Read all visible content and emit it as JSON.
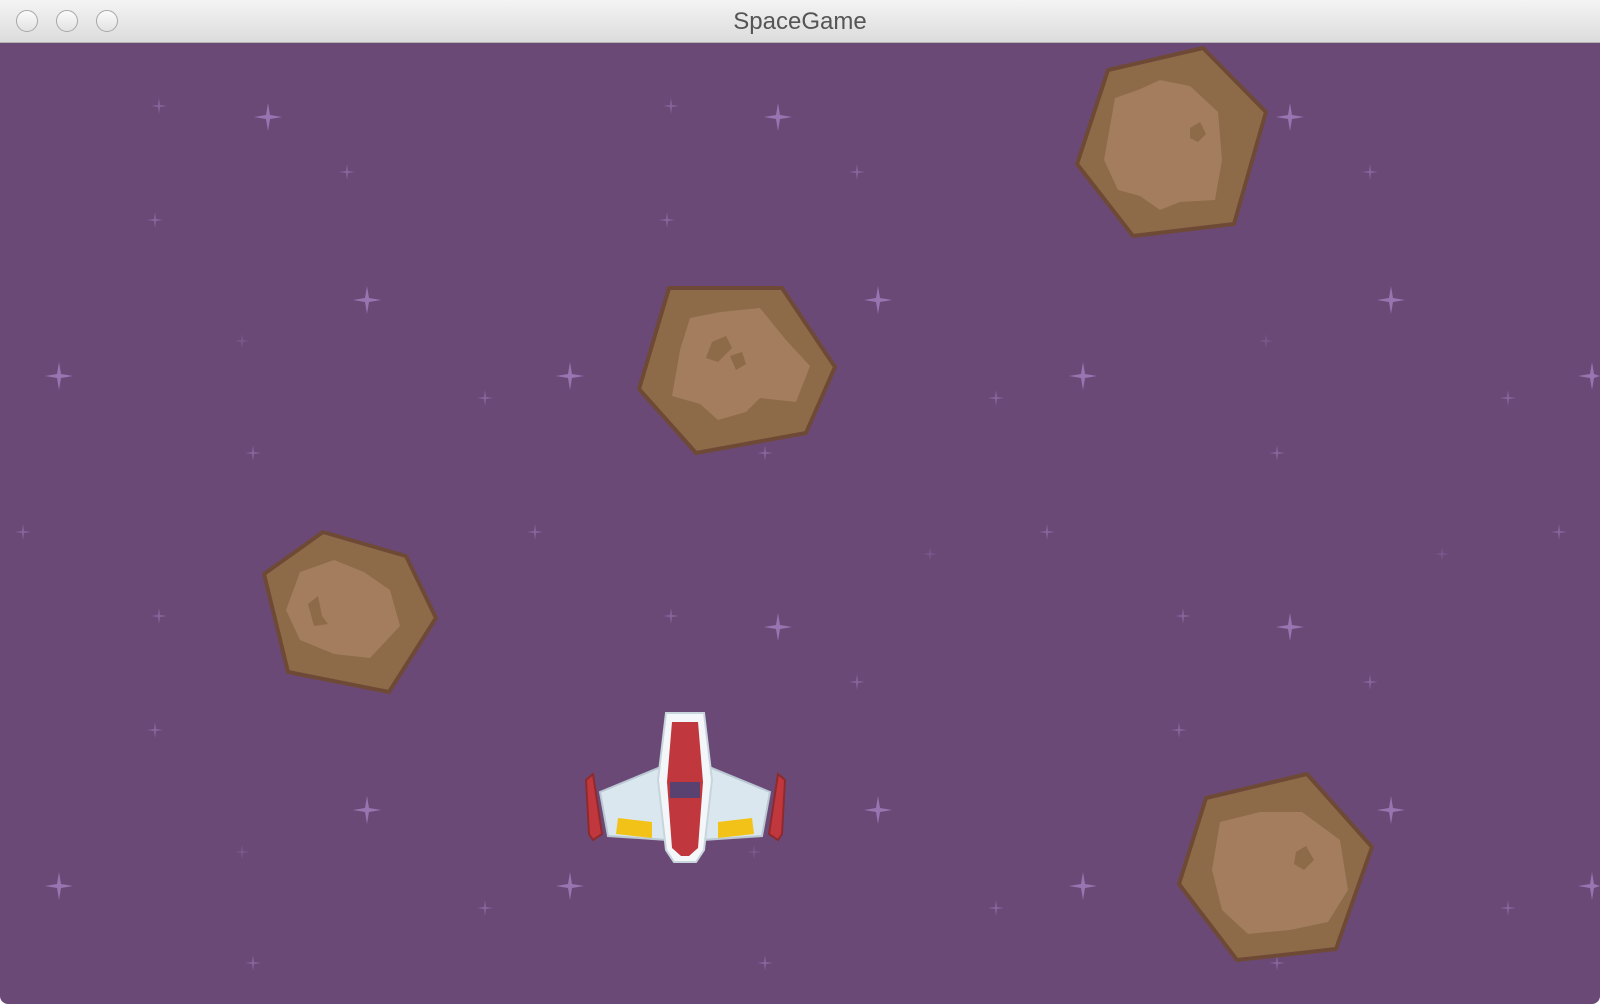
{
  "window": {
    "title": "SpaceGame"
  },
  "colors": {
    "space": "#6b4977",
    "star_bright": "#9d7ab8",
    "star_dim": "#8a66a3",
    "asteroid_outline": "#6e4a36",
    "asteroid_body": "#8d6a48",
    "asteroid_core": "#a37d5e",
    "ship_hull": "#dbe7ee",
    "ship_red": "#c0383d",
    "ship_glass": "#5a4270",
    "ship_thruster": "#f2c218"
  },
  "scene": {
    "asteroid_count": 4,
    "player_ship": "red-white-fighter"
  }
}
